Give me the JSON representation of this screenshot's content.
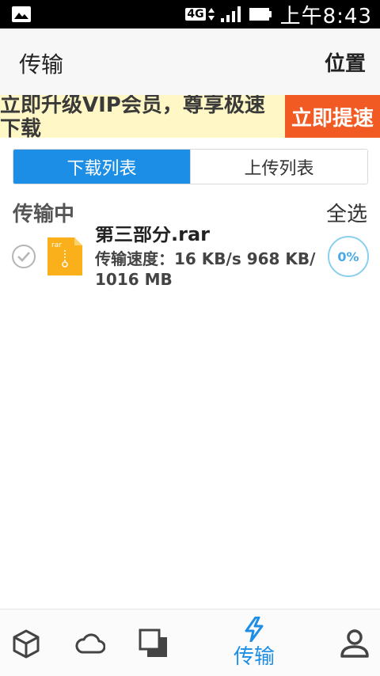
{
  "status_bar": {
    "network": "4G",
    "time": "上午8:43"
  },
  "header": {
    "title": "传输",
    "action": "位置"
  },
  "banner": {
    "text": "立即升级VIP会员，尊享极速下载",
    "button": "立即提速"
  },
  "tabs": [
    {
      "label": "下载列表",
      "active": true
    },
    {
      "label": "上传列表",
      "active": false
    }
  ],
  "section": {
    "title": "传输中",
    "select_all": "全选"
  },
  "transfers": [
    {
      "name": "第三部分.rar",
      "file_type": "rar",
      "speed_line": "传输速度：16 KB/s 968 KB/ 1016 MB",
      "progress": "0%"
    }
  ],
  "bottom_nav": [
    {
      "icon": "box-icon",
      "label": ""
    },
    {
      "icon": "cloud-icon",
      "label": ""
    },
    {
      "icon": "stacked-squares-icon",
      "label": ""
    },
    {
      "icon": "lightning-icon",
      "label": "传输",
      "active": true
    },
    {
      "icon": "user-icon",
      "label": ""
    }
  ],
  "colors": {
    "accent": "#1c8ee6",
    "banner_bg": "#fff7c5",
    "banner_button": "#f15a22",
    "file_icon": "#f9b01b",
    "progress_ring": "#8bcff0"
  }
}
